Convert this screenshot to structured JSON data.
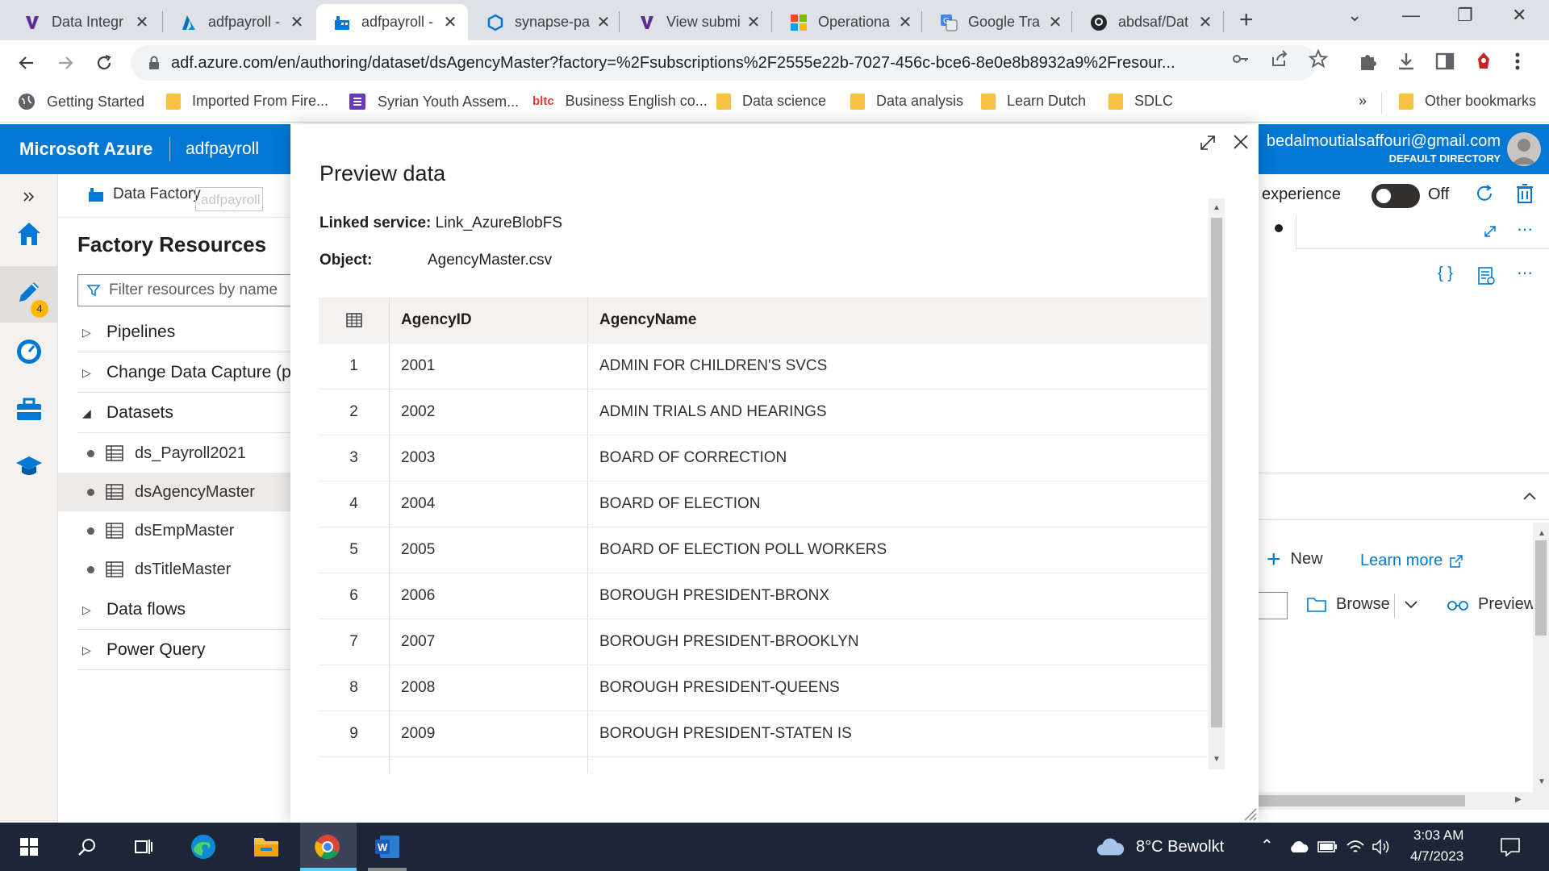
{
  "browser": {
    "tabs": [
      {
        "title": "Data Integr",
        "active": false
      },
      {
        "title": "adfpayroll -",
        "active": false
      },
      {
        "title": "adfpayroll -",
        "active": true
      },
      {
        "title": "synapse-pa",
        "active": false
      },
      {
        "title": "View submi",
        "active": false
      },
      {
        "title": "Operationa",
        "active": false
      },
      {
        "title": "Google Tra",
        "active": false
      },
      {
        "title": "abdsaf/Dat",
        "active": false
      }
    ],
    "url": "adf.azure.com/en/authoring/dataset/dsAgencyMaster?factory=%2Fsubscriptions%2F2555e22b-7027-456c-bce6-8e0e8b8932a9%2Fresour...",
    "bookmarks": [
      "Getting Started",
      "Imported From Fire...",
      "Syrian Youth Assem...",
      "Business English co...",
      "Data science",
      "Data analysis",
      "Learn Dutch",
      "SDLC"
    ],
    "bookmarks_overflow": "»",
    "other_bookmarks": "Other bookmarks"
  },
  "azure": {
    "brand": "Microsoft Azure",
    "factory_name": "adfpayroll",
    "user_email": "bedalmoutialsaffouri@gmail.com",
    "directory": "DEFAULT DIRECTORY",
    "badge_count": "4"
  },
  "toolbar": {
    "data_factory_label": "Data Factory",
    "ghost_text": "adfpayroll"
  },
  "resources": {
    "heading": "Factory Resources",
    "filter_placeholder": "Filter resources by name",
    "sections": {
      "pipelines": "Pipelines",
      "cdc": "Change Data Capture (p",
      "datasets": "Datasets",
      "dataflows": "Data flows",
      "powerquery": "Power Query"
    },
    "datasets": [
      "ds_Payroll2021",
      "dsAgencyMaster",
      "dsEmpMaster",
      "dsTitleMaster"
    ]
  },
  "right_panel": {
    "experience": "experience",
    "toggle_state": "Off",
    "new_label": "New",
    "learn_more": "Learn more",
    "browse": "Browse",
    "preview": "Preview"
  },
  "modal": {
    "title": "Preview data",
    "linked_service_label": "Linked service:",
    "linked_service_value": "Link_AzureBlobFS",
    "object_label": "Object:",
    "object_value": "AgencyMaster.csv",
    "columns": [
      "AgencyID",
      "AgencyName"
    ],
    "rows": [
      {
        "n": "1",
        "id": "2001",
        "name": "ADMIN FOR CHILDREN'S SVCS"
      },
      {
        "n": "2",
        "id": "2002",
        "name": "ADMIN TRIALS AND HEARINGS"
      },
      {
        "n": "3",
        "id": "2003",
        "name": "BOARD OF CORRECTION"
      },
      {
        "n": "4",
        "id": "2004",
        "name": "BOARD OF ELECTION"
      },
      {
        "n": "5",
        "id": "2005",
        "name": "BOARD OF ELECTION POLL WORKERS"
      },
      {
        "n": "6",
        "id": "2006",
        "name": "BOROUGH PRESIDENT-BRONX"
      },
      {
        "n": "7",
        "id": "2007",
        "name": "BOROUGH PRESIDENT-BROOKLYN"
      },
      {
        "n": "8",
        "id": "2008",
        "name": "BOROUGH PRESIDENT-QUEENS"
      },
      {
        "n": "9",
        "id": "2009",
        "name": "BOROUGH PRESIDENT-STATEN IS"
      }
    ]
  },
  "taskbar": {
    "weather": "8°C  Bewolkt",
    "time": "3:03 AM",
    "date": "4/7/2023"
  },
  "colors": {
    "azure_blue": "#0078d4",
    "taskbar": "#1c2637",
    "tab_strip": "#dee1e6"
  }
}
